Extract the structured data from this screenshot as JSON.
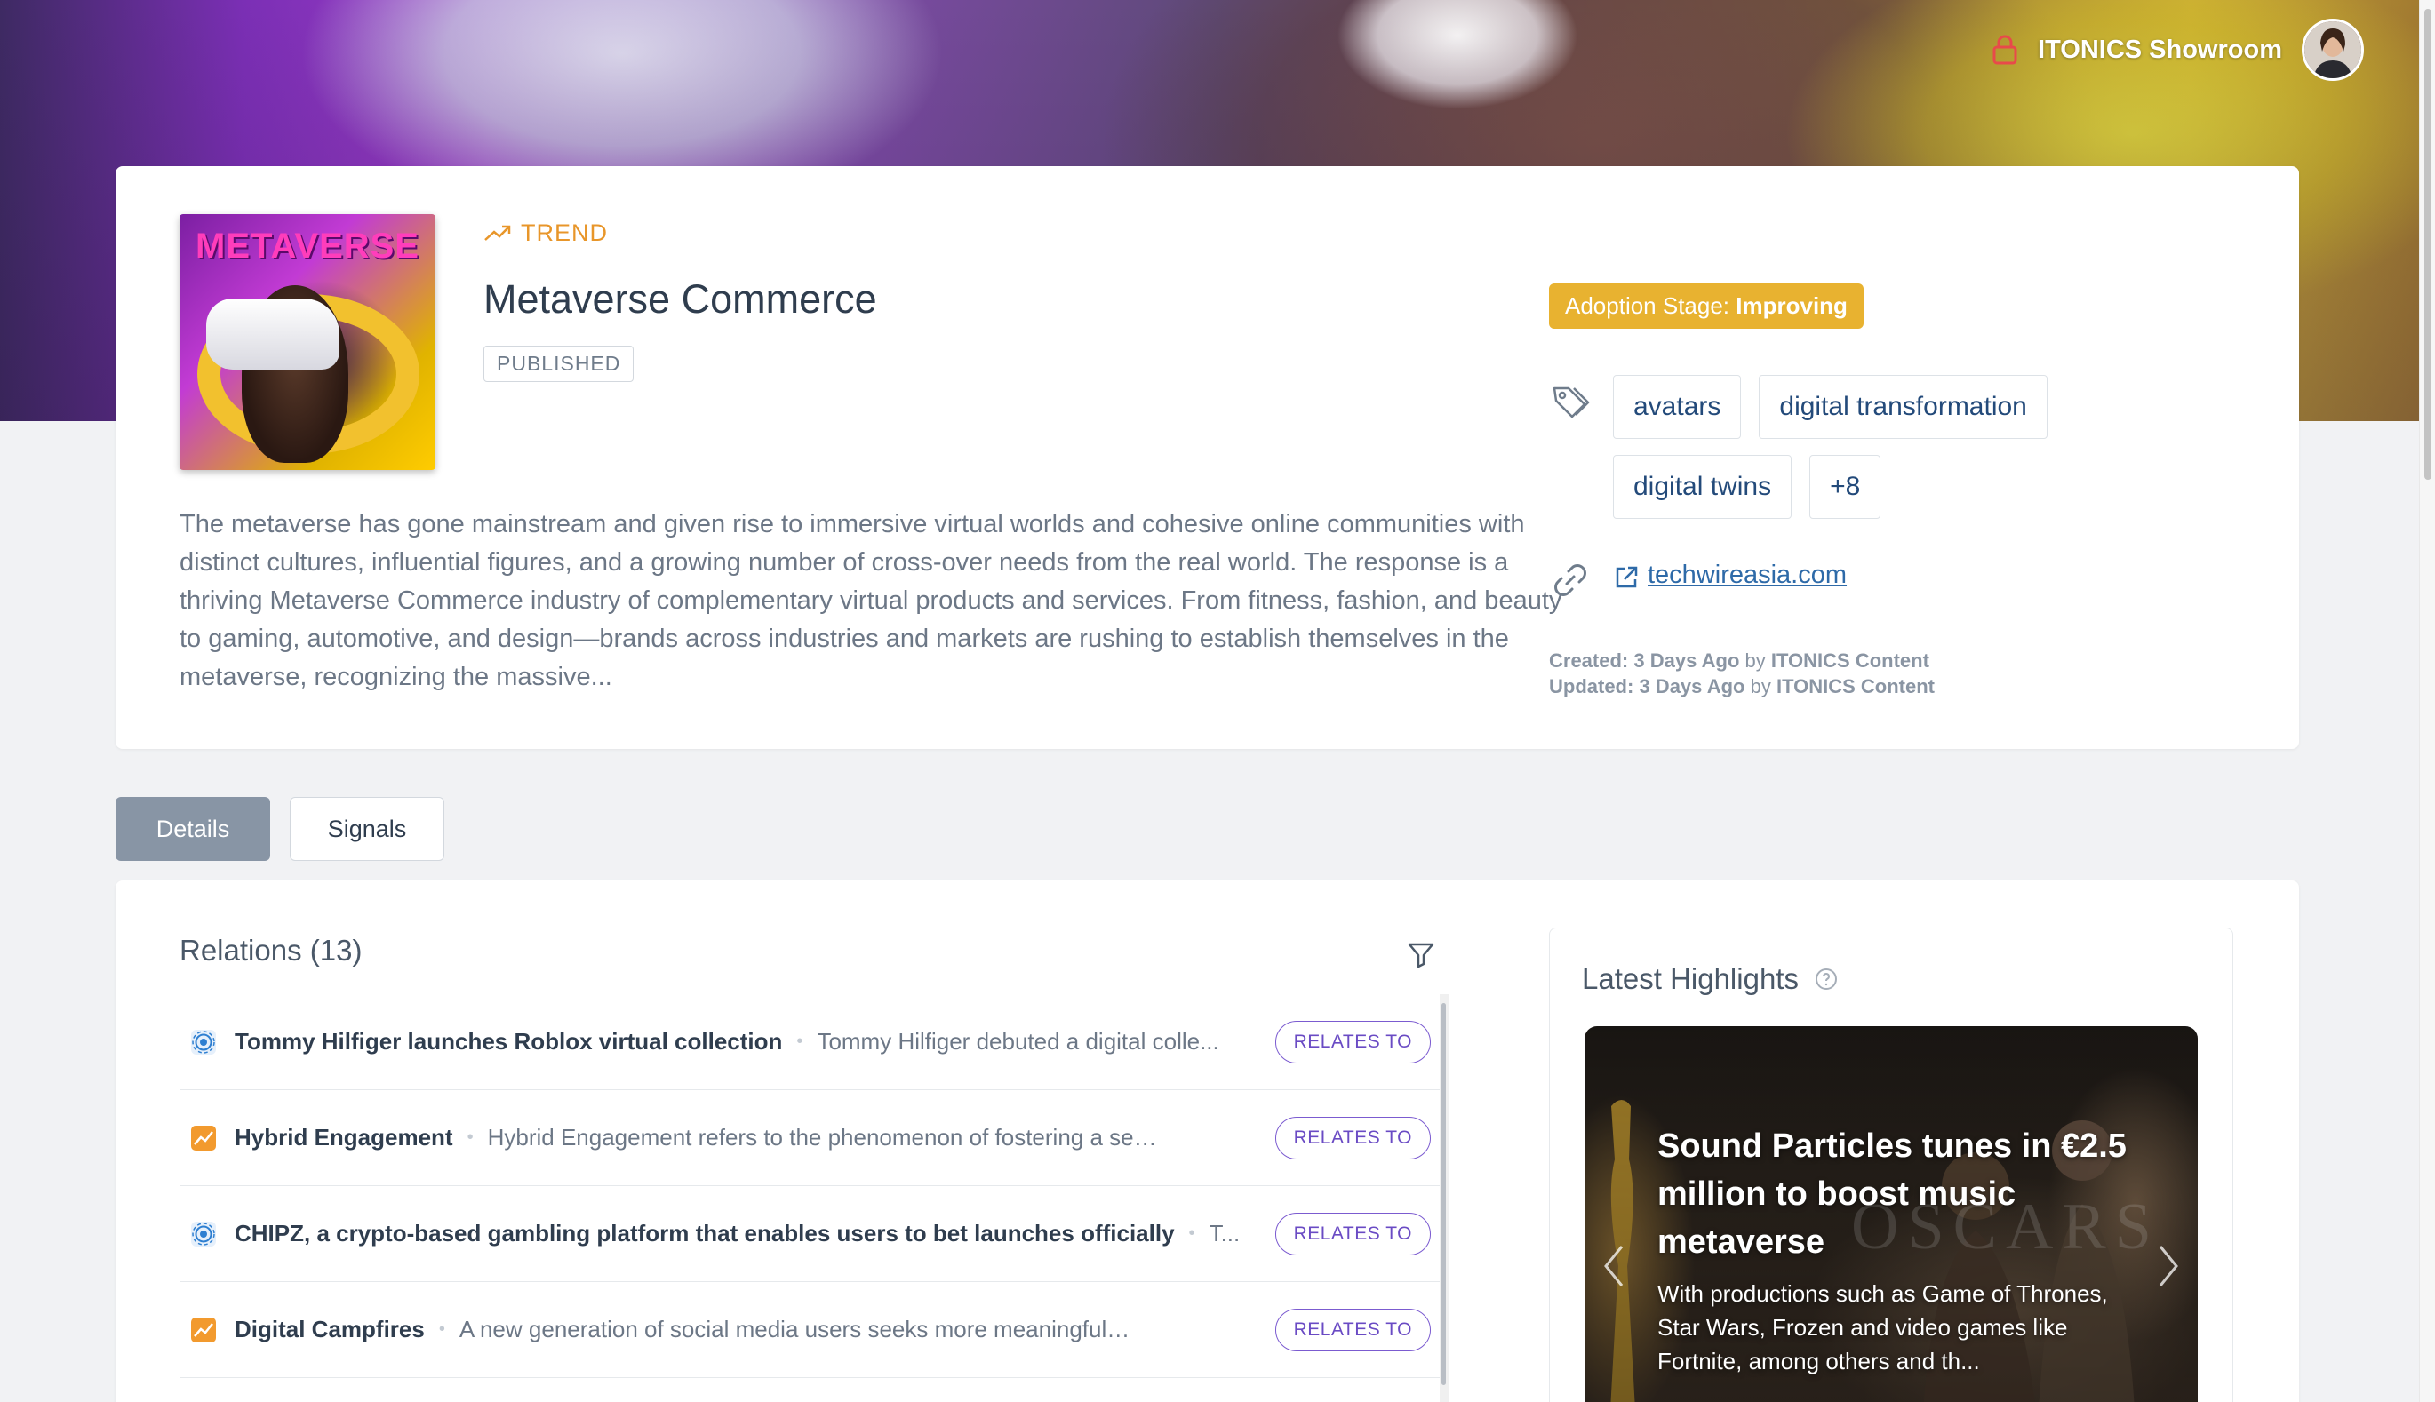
{
  "header": {
    "workspace_name": "ITONICS Showroom"
  },
  "item": {
    "kind_label": "TREND",
    "title": "Metaverse Commerce",
    "status": "PUBLISHED",
    "thumbnail_text": "METAVERSE",
    "description": "The metaverse has gone mainstream and given rise to immersive virtual worlds and cohesive online communities with distinct cultures, influential figures, and a growing number of cross-over needs from the real world. The response is a thriving Metaverse Commerce industry of complementary virtual products and services. From fitness, fashion, and beauty to gaming, automotive, and design—brands across industries and markets are rushing to establish themselves in the metaverse, recognizing the massive...",
    "adoption_label": "Adoption Stage: ",
    "adoption_value": "Improving",
    "tags": [
      "avatars",
      "digital transformation",
      "digital twins",
      "+8"
    ],
    "source_link": "techwireasia.com",
    "created_label": "Created:",
    "created_when": "3 Days Ago",
    "updated_label": "Updated:",
    "updated_when": "3 Days Ago",
    "by_label": "by",
    "author": "ITONICS Content"
  },
  "tabs": [
    {
      "label": "Details",
      "active": true
    },
    {
      "label": "Signals",
      "active": false
    }
  ],
  "relations": {
    "title": "Relations (13)",
    "items": [
      {
        "type": "signal",
        "name": "Tommy Hilfiger launches Roblox virtual collection",
        "description": "Tommy Hilfiger debuted a digital colle...",
        "relation": "RELATES TO"
      },
      {
        "type": "trend",
        "name": "Hybrid Engagement",
        "description": "Hybrid Engagement refers to the phenomenon of fostering a sense ...",
        "relation": "RELATES TO"
      },
      {
        "type": "signal",
        "name": "CHIPZ, a crypto-based gambling platform that enables users to bet launches officially",
        "description": "T...",
        "relation": "RELATES TO"
      },
      {
        "type": "trend",
        "name": "Digital Campfires",
        "description": "A new generation of social media users seeks more meaningful connec...",
        "relation": "RELATES TO"
      }
    ]
  },
  "highlights": {
    "title": "Latest Highlights",
    "headline": "Sound Particles tunes in €2.5 million to boost music metaverse",
    "summary": "With productions such as Game of Thrones, Star Wars, Frozen and video games like Fortnite, among others and th..."
  },
  "colors": {
    "accent_orange": "#e8962a",
    "adoption_badge": "#e8b230",
    "relation_badge": "#7b5bd0",
    "tab_active": "#8895a5",
    "link": "#2e6aa8"
  }
}
